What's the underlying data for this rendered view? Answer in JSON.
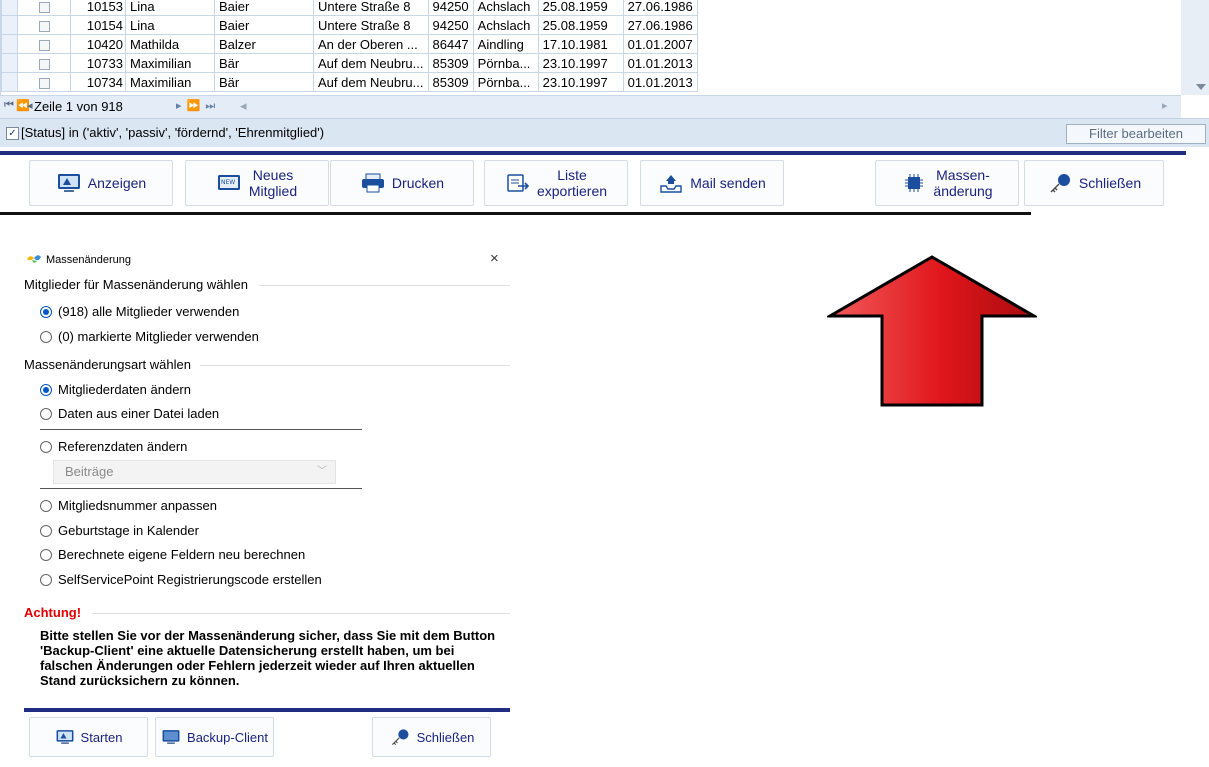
{
  "grid": {
    "rows": [
      {
        "id": "10153",
        "first": "Lina",
        "last": "Baier",
        "street": "Untere Straße 8",
        "plz": "94250",
        "city": "Achslach",
        "birth": "25.08.1959",
        "entry": "27.06.1986"
      },
      {
        "id": "10154",
        "first": "Lina",
        "last": "Baier",
        "street": "Untere Straße 8",
        "plz": "94250",
        "city": "Achslach",
        "birth": "25.08.1959",
        "entry": "27.06.1986"
      },
      {
        "id": "10420",
        "first": "Mathilda",
        "last": "Balzer",
        "street": "An der Oberen ...",
        "plz": "86447",
        "city": "Aindling",
        "birth": "17.10.1981",
        "entry": "01.01.2007"
      },
      {
        "id": "10733",
        "first": "Maximilian",
        "last": "Bär",
        "street": "Auf dem Neubru...",
        "plz": "85309",
        "city": "Pörnba...",
        "birth": "23.10.1997",
        "entry": "01.01.2013"
      },
      {
        "id": "10734",
        "first": "Maximilian",
        "last": "Bär",
        "street": "Auf dem Neubru...",
        "plz": "85309",
        "city": "Pörnba...",
        "birth": "23.10.1997",
        "entry": "01.01.2013"
      }
    ],
    "navigator": {
      "row_text": "Zeile 1 von 918"
    }
  },
  "filter": {
    "expression": "[Status] in ('aktiv', 'passiv', 'fördernd', 'Ehrenmitglied')",
    "edit_button": "Filter bearbeiten"
  },
  "toolbar": {
    "anzeigen": "Anzeigen",
    "neues_line1": "Neues",
    "neues_line2": "Mitglied",
    "drucken": "Drucken",
    "liste_line1": "Liste",
    "liste_line2": "exportieren",
    "mail": "Mail senden",
    "massen_line1": "Massen-",
    "massen_line2": "änderung",
    "schliessen": "Schließen"
  },
  "dialog": {
    "title": "Massenänderung",
    "close_glyph": "×",
    "group1_title": "Mitglieder für Massenänderung wählen",
    "opt_all": "(918) alle Mitglieder verwenden",
    "opt_marked": "(0) markierte Mitglieder verwenden",
    "group2_title": "Massenänderungsart wählen",
    "opt_member_data": "Mitgliederdaten ändern",
    "opt_file": "Daten aus einer Datei laden",
    "opt_reference": "Referenzdaten ändern",
    "combo_value": "Beiträge",
    "opt_number": "Mitgliedsnummer anpassen",
    "opt_birthdays": "Geburtstage in Kalender",
    "opt_recalc": "Berechnete eigene Feldern neu berechnen",
    "opt_selfservice": "SelfServicePoint Registrierungscode erstellen",
    "warning_title": "Achtung!",
    "warning_text": "Bitte stellen Sie vor der Massenänderung sicher, dass Sie mit dem Button 'Backup-Client' eine aktuelle Datensicherung erstellt haben, um bei falschen Änderungen oder Fehlern jederzeit wieder auf Ihren aktuellen Stand zurücksichern zu können.",
    "btn_start": "Starten",
    "btn_backup": "Backup-Client",
    "btn_close": "Schließen"
  },
  "colors": {
    "navy": "#1f2e82",
    "warning": "#e20000",
    "arrow": "#e0161b",
    "link": "#1a237e"
  }
}
